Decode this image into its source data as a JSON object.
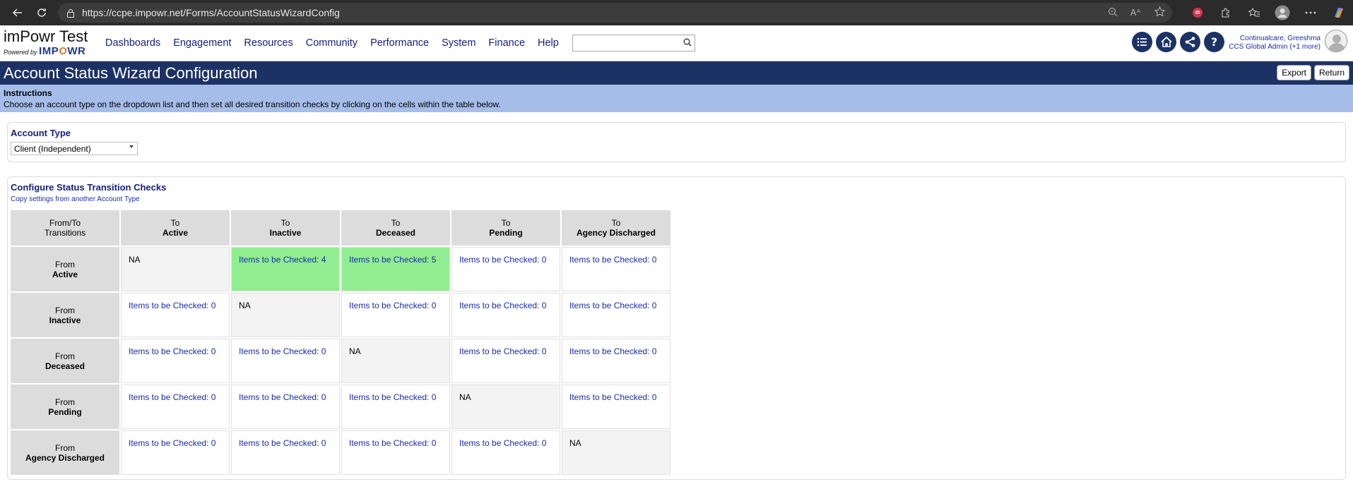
{
  "browser": {
    "url": "https://ccpe.impowr.net/Forms/AccountStatusWizardConfig"
  },
  "header": {
    "brand_title": "imPowr Test",
    "brand_powered": "Powered by",
    "brand_logo_a": "IMP",
    "brand_logo_o": "O",
    "brand_logo_b": "WR",
    "menu": [
      "Dashboards",
      "Engagement",
      "Resources",
      "Community",
      "Performance",
      "System",
      "Finance",
      "Help"
    ],
    "search_placeholder": "",
    "user_name": "Continualcare, Greeshma",
    "user_role": "CCS Global Admin (+1 more)"
  },
  "page": {
    "title": "Account Status Wizard Configuration",
    "export_label": "Export",
    "return_label": "Return"
  },
  "instructions": {
    "title": "Instructions",
    "text": "Choose an account type on the dropdown list and then set all desired transition checks by clicking on the cells within the table below."
  },
  "account_type": {
    "title": "Account Type",
    "selected": "Client (Independent)"
  },
  "transitions": {
    "title": "Configure Status Transition Checks",
    "copy_link": "Copy settings from another Account Type",
    "corner_line1": "From/To",
    "corner_line2": "Transitions",
    "to_prefix": "To",
    "from_prefix": "From",
    "statuses": [
      "Active",
      "Inactive",
      "Deceased",
      "Pending",
      "Agency Discharged"
    ],
    "rows": [
      [
        "NA",
        "Items to be Checked: 4",
        "Items to be Checked: 5",
        "Items to be Checked: 0",
        "Items to be Checked: 0"
      ],
      [
        "Items to be Checked: 0",
        "NA",
        "Items to be Checked: 0",
        "Items to be Checked: 0",
        "Items to be Checked: 0"
      ],
      [
        "Items to be Checked: 0",
        "Items to be Checked: 0",
        "NA",
        "Items to be Checked: 0",
        "Items to be Checked: 0"
      ],
      [
        "Items to be Checked: 0",
        "Items to be Checked: 0",
        "Items to be Checked: 0",
        "NA",
        "Items to be Checked: 0"
      ],
      [
        "Items to be Checked: 0",
        "Items to be Checked: 0",
        "Items to be Checked: 0",
        "Items to be Checked: 0",
        "NA"
      ]
    ],
    "highlight_color": "#90ee90"
  }
}
